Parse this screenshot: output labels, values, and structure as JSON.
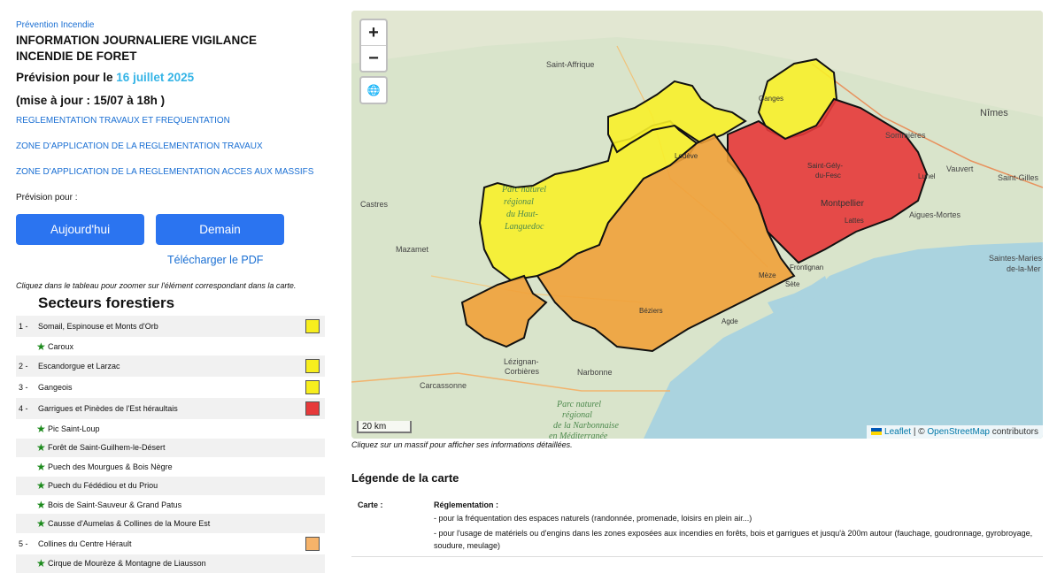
{
  "header": {
    "kicker": "Prévention Incendie",
    "title": "INFORMATION JOURNALIERE VIGILANCE INCENDIE DE FORET",
    "forecast_prefix": "Prévision pour le",
    "forecast_date": "16 juillet 2025",
    "update": "(mise à jour : 15/07 à 18h )"
  },
  "links": {
    "reglementation": "REGLEMENTATION TRAVAUX ET FREQUENTATION",
    "zone_travaux": "ZONE D'APPLICATION DE LA REGLEMENTATION TRAVAUX",
    "zone_acces": "ZONE D'APPLICATION DE LA REGLEMENTATION ACCES AUX MASSIFS"
  },
  "controls": {
    "prevision_pour": "Prévision pour :",
    "today": "Aujourd'hui",
    "tomorrow": "Demain",
    "pdf": "Télécharger le PDF",
    "hint": "Cliquez dans le tableau pour zoomer sur l'élément correspondant dans la carte."
  },
  "sectors": {
    "title": "Secteurs forestiers",
    "rows": [
      {
        "num": "1 -",
        "label": "Somail, Espinouse et Monts d'Orb",
        "color": "#f7ee1e"
      },
      {
        "sub": true,
        "label": "Caroux"
      },
      {
        "num": "2 -",
        "label": "Escandorgue et Larzac",
        "color": "#f7ee1e"
      },
      {
        "num": "3 -",
        "label": "Gangeois",
        "color": "#f7ee1e"
      },
      {
        "num": "4 -",
        "label": "Garrigues et Pinèdes de l'Est héraultais",
        "color": "#e6393a"
      },
      {
        "sub": true,
        "label": "Pic Saint-Loup"
      },
      {
        "sub": true,
        "label": "Forêt de Saint-Guilhem-le-Désert"
      },
      {
        "sub": true,
        "label": "Puech des Mourgues & Bois Nègre"
      },
      {
        "sub": true,
        "label": "Puech du Fédédiou et du Priou"
      },
      {
        "sub": true,
        "label": "Bois de Saint-Sauveur & Grand Patus"
      },
      {
        "sub": true,
        "label": "Causse d'Aumelas & Collines de la Moure Est"
      },
      {
        "num": "5 -",
        "label": "Collines du Centre Hérault",
        "color": "#f6b36a"
      },
      {
        "sub": true,
        "label": "Cirque de Mourèze & Montagne de Liausson"
      }
    ]
  },
  "map": {
    "zoom_in": "+",
    "zoom_out": "−",
    "scale": "20 km",
    "attrib_leaflet": "Leaflet",
    "attrib_sep": " | © ",
    "attrib_osm": "OpenStreetMap",
    "attrib_tail": " contributors",
    "place_labels": [
      "Saint-Affrique",
      "Ganges",
      "Nîmes",
      "Sommières",
      "Vauvert",
      "Saint-Gilles",
      "Lodève",
      "Saint-Gély-du-Fesc",
      "Lunel",
      "Castres",
      "Montpellier",
      "Lattes",
      "Aigues-Mortes",
      "Mazamet",
      "Frontignan",
      "Saintes-Maries-de-la-Mer",
      "Mèze",
      "Sète",
      "Béziers",
      "Agde",
      "Carcassonne",
      "Lézignan-Corbières",
      "Narbonne",
      "Parc naturel régional du Haut-Languedoc",
      "Parc naturel régional de la Narbonnaise en Méditerranée"
    ],
    "caption": "Cliquez sur un massif pour afficher ses informations détaillées."
  },
  "legend": {
    "title": "Légende de la carte",
    "key": "Carte :",
    "heading": "Réglementation :",
    "line1": "- pour la fréquentation des espaces naturels (randonnée, promenade, loisirs en plein air...)",
    "line2": "- pour l'usage de matériels ou d'engins dans les zones exposées aux incendies en forêts, bois et garrigues et jusqu'à 200m autour (fauchage, goudronnage, gyrobroyage, soudure, meulage)"
  }
}
